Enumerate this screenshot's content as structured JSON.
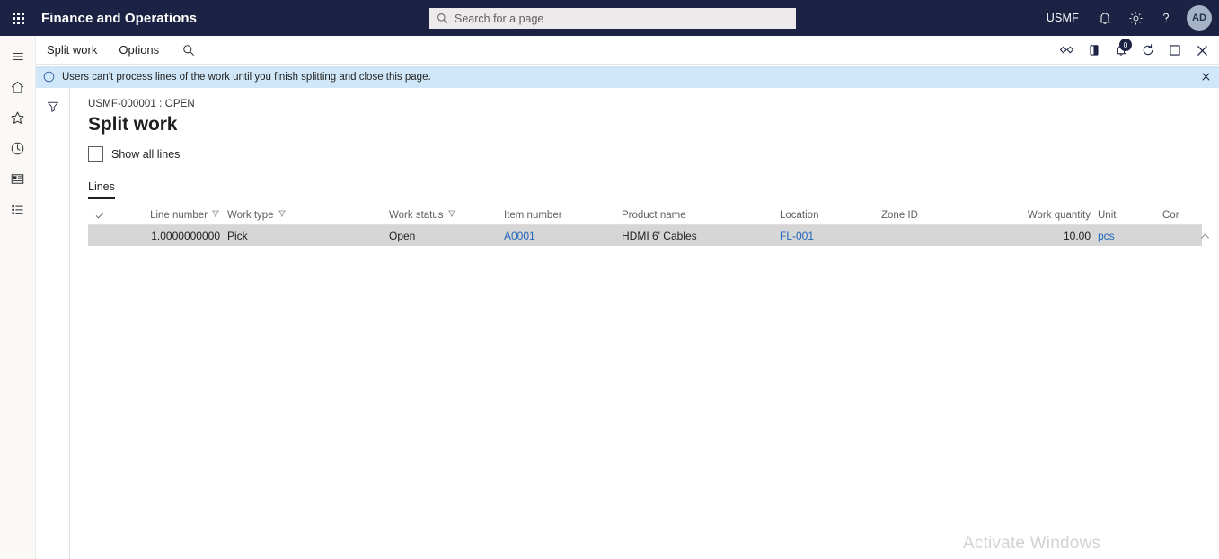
{
  "topbar": {
    "waffle_icon": "app-launcher-icon",
    "app_title": "Finance and Operations",
    "search": {
      "placeholder": "Search for a page",
      "value": "",
      "icon": "search-icon"
    },
    "company": "USMF",
    "notifications_icon": "bell-icon",
    "settings_icon": "gear-icon",
    "help_icon": "question-mark-icon",
    "avatar_initials": "AD",
    "background_color": "#1b2243"
  },
  "commandbar": {
    "tabs": [
      {
        "label": "Split work",
        "name": "tab-split-work"
      },
      {
        "label": "Options",
        "name": "tab-options"
      }
    ],
    "search_icon": "search-icon",
    "right_icons": [
      {
        "name": "personalize-icon",
        "badge": null
      },
      {
        "name": "attachments-icon",
        "badge": null
      },
      {
        "name": "notifications-icon",
        "badge": "0"
      },
      {
        "name": "refresh-icon",
        "badge": null
      },
      {
        "name": "open-in-new-window-icon",
        "badge": null
      },
      {
        "name": "close-icon",
        "badge": null
      }
    ]
  },
  "messagebar": {
    "icon": "info-icon",
    "text": "Users can't process lines of the work until you finish splitting and close this page.",
    "close_icon": "close-icon",
    "background_color": "#cfe7f8"
  },
  "rail": {
    "items": [
      {
        "name": "hamburger-menu-icon",
        "label": "Expand navigation"
      },
      {
        "name": "home-icon",
        "label": "Home"
      },
      {
        "name": "star-icon",
        "label": "Favorites"
      },
      {
        "name": "clock-icon",
        "label": "Recent"
      },
      {
        "name": "workspace-icon",
        "label": "Workspaces"
      },
      {
        "name": "modules-list-icon",
        "label": "Modules"
      }
    ]
  },
  "filterpane": {
    "icon": "filter-icon"
  },
  "page": {
    "breadcrumb": "USMF-000001 : OPEN",
    "title": "Split work",
    "show_all_lines": {
      "label": "Show all lines",
      "checked": false
    },
    "tabs": [
      {
        "label": "Lines",
        "selected": true
      }
    ]
  },
  "grid": {
    "columns": [
      {
        "key": "select",
        "label": "",
        "filter": false,
        "align": "center"
      },
      {
        "key": "line_number",
        "label": "Line number",
        "filter": true,
        "align": "right"
      },
      {
        "key": "work_type",
        "label": "Work type",
        "filter": true,
        "align": "left"
      },
      {
        "key": "work_status",
        "label": "Work status",
        "filter": true,
        "align": "left"
      },
      {
        "key": "item_number",
        "label": "Item number",
        "filter": false,
        "align": "left"
      },
      {
        "key": "product_name",
        "label": "Product name",
        "filter": false,
        "align": "left"
      },
      {
        "key": "location",
        "label": "Location",
        "filter": false,
        "align": "left"
      },
      {
        "key": "zone_id",
        "label": "Zone ID",
        "filter": false,
        "align": "left"
      },
      {
        "key": "work_qty",
        "label": "Work quantity",
        "filter": false,
        "align": "right"
      },
      {
        "key": "unit",
        "label": "Unit",
        "filter": false,
        "align": "left"
      },
      {
        "key": "cor",
        "label": "Cor",
        "filter": false,
        "align": "left"
      }
    ],
    "header_select_icon": "checkmark-icon",
    "rows": [
      {
        "line_number": "1.0000000000",
        "work_type": "Pick",
        "work_status": "Open",
        "item_number": "A0001",
        "product_name": "HDMI 6' Cables",
        "location": "FL-001",
        "zone_id": "",
        "work_qty": "10.00",
        "unit": "pcs",
        "cor": "",
        "selected": true,
        "collapse_icon": "chevron-up-icon"
      }
    ],
    "link_color": "#2266bb",
    "selected_row_color": "#d6d6d6"
  },
  "watermark": {
    "text": "Activate Windows"
  }
}
